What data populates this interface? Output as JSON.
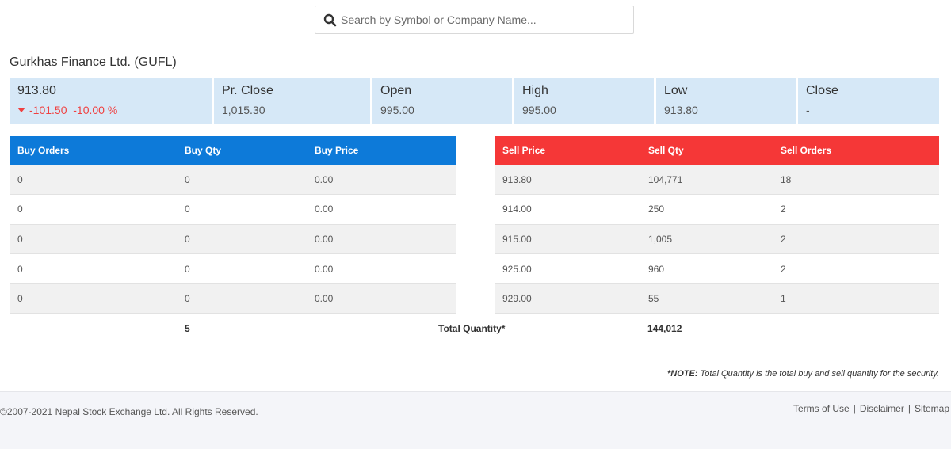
{
  "search": {
    "placeholder": "Search by Symbol or Company Name..."
  },
  "company": {
    "title": "Gurkhas Finance Ltd. (GUFL)"
  },
  "stats": {
    "ltp": "913.80",
    "change": "-101.50  -10.00 %",
    "change_direction_icon": "triangle-down-icon",
    "pr_close_label": "Pr. Close",
    "pr_close_value": "1,015.30",
    "open_label": "Open",
    "open_value": "995.00",
    "high_label": "High",
    "high_value": "995.00",
    "low_label": "Low",
    "low_value": "913.80",
    "close_label": "Close",
    "close_value": "-"
  },
  "buy": {
    "headers": [
      "Buy Orders",
      "Buy Qty",
      "Buy Price"
    ],
    "rows": [
      [
        "0",
        "0",
        "0.00"
      ],
      [
        "0",
        "0",
        "0.00"
      ],
      [
        "0",
        "0",
        "0.00"
      ],
      [
        "0",
        "0",
        "0.00"
      ],
      [
        "0",
        "0",
        "0.00"
      ]
    ]
  },
  "sell": {
    "headers": [
      "Sell Price",
      "Sell Qty",
      "Sell Orders"
    ],
    "rows": [
      [
        "913.80",
        "104,771",
        "18"
      ],
      [
        "914.00",
        "250",
        "2"
      ],
      [
        "915.00",
        "1,005",
        "2"
      ],
      [
        "925.00",
        "960",
        "2"
      ],
      [
        "929.00",
        "55",
        "1"
      ]
    ]
  },
  "totals": {
    "buy_qty": "5",
    "label": "Total Quantity*",
    "sell_qty": "144,012"
  },
  "note": {
    "prefix": "*NOTE:",
    "text": " Total Quantity is the total buy and sell quantity for the security."
  },
  "footer": {
    "copyright": "©2007-2021 Nepal Stock Exchange Ltd. All Rights Reserved.",
    "links": [
      "Terms of Use",
      "Disclaimer",
      "Sitemap"
    ]
  },
  "colors": {
    "buy_header": "#0d7ad9",
    "sell_header": "#f53737",
    "stat_bg": "#d6e8f7",
    "negative": "#f04040"
  }
}
